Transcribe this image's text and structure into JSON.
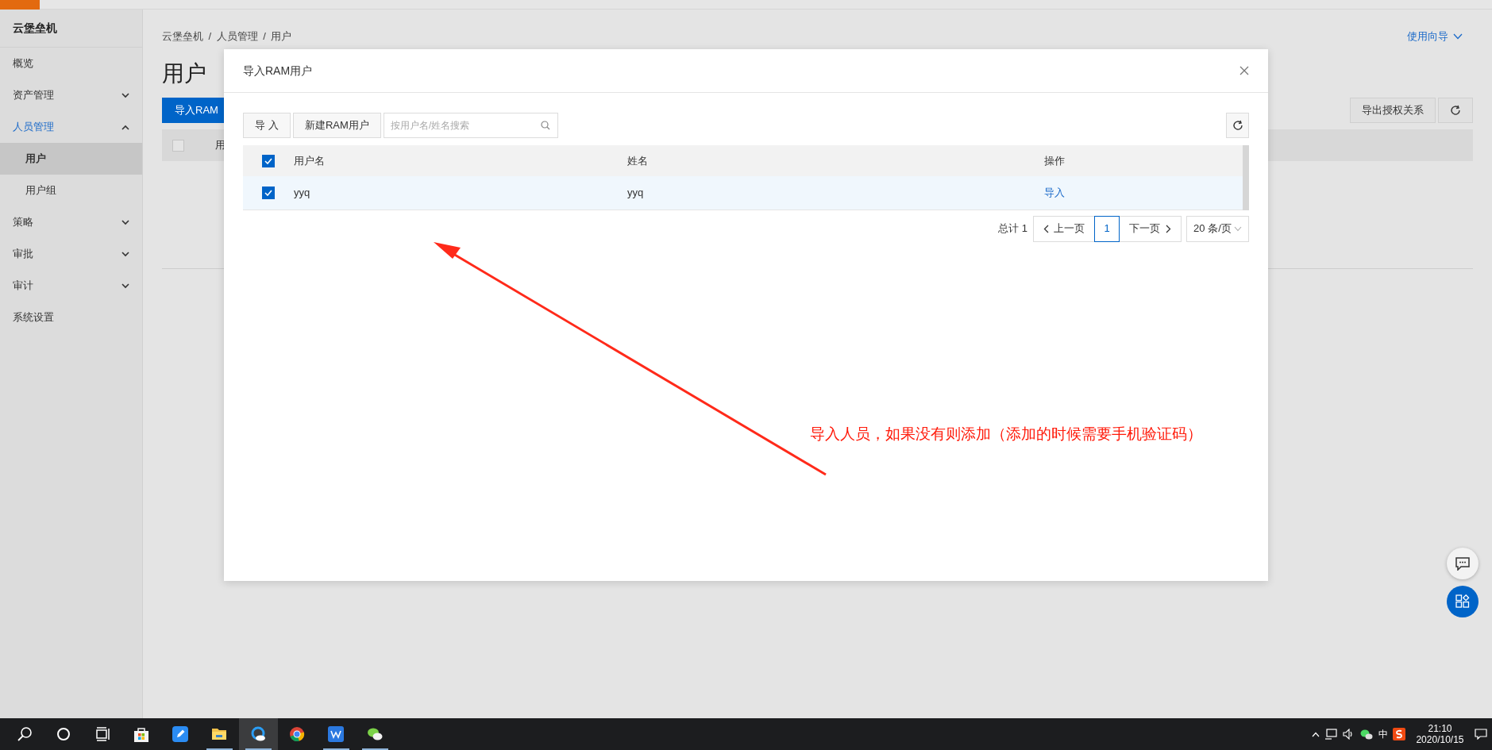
{
  "sidebar": {
    "title": "云堡垒机",
    "items": [
      {
        "label": "概览",
        "kind": "link",
        "selected": false
      },
      {
        "label": "资产管理",
        "kind": "group",
        "expanded": false,
        "selected": false
      },
      {
        "label": "人员管理",
        "kind": "group",
        "expanded": true,
        "selected": true,
        "children": [
          {
            "label": "用户",
            "kind": "link",
            "selected": true
          },
          {
            "label": "用户组",
            "kind": "link",
            "selected": false
          }
        ]
      },
      {
        "label": "策略",
        "kind": "group",
        "expanded": false,
        "selected": false
      },
      {
        "label": "审批",
        "kind": "group",
        "expanded": false,
        "selected": false
      },
      {
        "label": "审计",
        "kind": "group",
        "expanded": false,
        "selected": false
      },
      {
        "label": "系统设置",
        "kind": "link",
        "selected": false
      }
    ]
  },
  "page": {
    "breadcrumb": [
      {
        "label": "云堡垒机",
        "separator": "/"
      },
      {
        "label": "人员管理",
        "separator": "/"
      },
      {
        "label": "用户"
      }
    ],
    "guide_link": "使用向导",
    "title": "用户",
    "primary_button": "导入RAM",
    "export_button": "导出授权关系",
    "table": {
      "checked": false,
      "column_1": "用"
    }
  },
  "modal": {
    "title": "导入RAM用户",
    "buttons": [
      "导 入",
      "新建RAM用户"
    ],
    "search": {
      "placeholder": "按用户名/姓名搜索"
    },
    "table": {
      "header_checked": true,
      "columns": [
        "用户名",
        "姓名",
        "操作"
      ],
      "rows": [
        {
          "selected": true,
          "username": "yyq",
          "name": "yyq",
          "action": "导入"
        }
      ]
    },
    "pagination": {
      "total": "总计 1",
      "prev": "上一页",
      "pages": [
        {
          "label": "1",
          "selected": true
        }
      ],
      "next": "下一页",
      "page_size": "20 条/页"
    }
  },
  "annotation": "导入人员，如果没有则添加（添加的时候需要手机验证码）",
  "taskbar": {
    "apps": [
      {
        "kind": "search",
        "running": false,
        "selected": false
      },
      {
        "kind": "cortana",
        "running": false,
        "selected": false
      },
      {
        "kind": "taskview",
        "running": false,
        "selected": false
      },
      {
        "kind": "store",
        "running": false,
        "selected": false
      },
      {
        "kind": "pen",
        "running": false,
        "selected": false
      },
      {
        "kind": "folder",
        "running": true,
        "selected": false
      },
      {
        "kind": "cloud",
        "running": true,
        "selected": true
      },
      {
        "kind": "chrome",
        "running": false,
        "selected": false
      },
      {
        "kind": "wps",
        "running": true,
        "selected": false
      },
      {
        "kind": "chat",
        "running": true,
        "selected": false
      }
    ],
    "ime": "中",
    "time": "21:10",
    "date": "2020/10/15"
  }
}
